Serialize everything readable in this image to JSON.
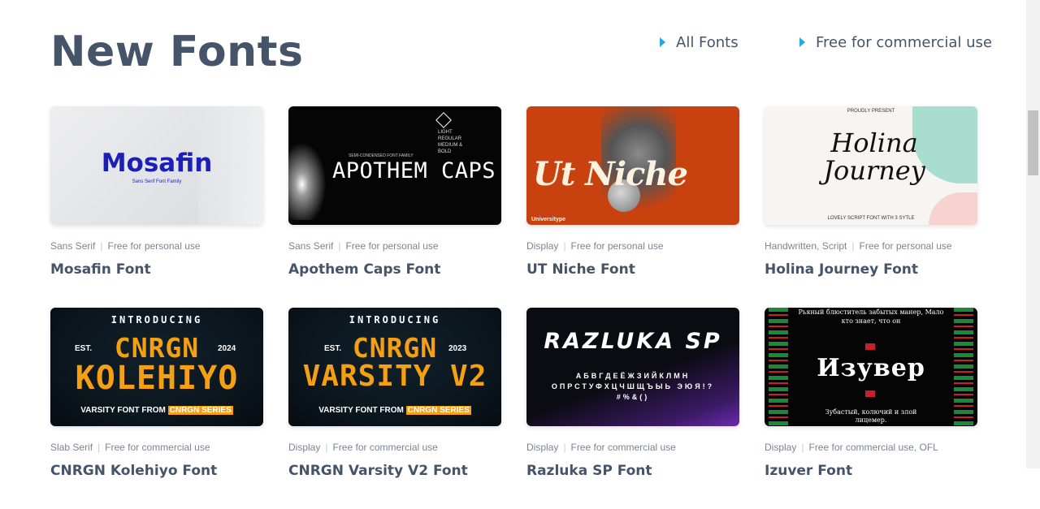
{
  "header": {
    "title": "New Fonts",
    "links": [
      {
        "label": "All Fonts"
      },
      {
        "label": "Free for commercial use"
      }
    ]
  },
  "accent_color": "#25a9e0",
  "cards": [
    {
      "category": "Sans Serif",
      "license": "Free for personal use",
      "name": "Mosafin Font",
      "thumb": {
        "text": "Mosafin",
        "sub": "Sans Serif Font Family"
      }
    },
    {
      "category": "Sans Serif",
      "license": "Free for personal use",
      "name": "Apothem Caps Font",
      "thumb": {
        "text": "APOTHEM CAPS",
        "sub": "SEMI-CONDENSED FONT FAMILY",
        "weights": "LIGHT REGULAR MEDIUM & BOLD"
      }
    },
    {
      "category": "Display",
      "license": "Free for personal use",
      "name": "UT Niche Font",
      "thumb": {
        "text": "Ut Niche",
        "brand": "Universitype"
      }
    },
    {
      "category": "Handwritten, Script",
      "license": "Free for personal use",
      "name": "Holina Journey Font",
      "thumb": {
        "top": "PROUDLY PRESENT",
        "text": "Holina Journey",
        "foot": "LOVELY SCRIPT FONT WITH 3 SYTLE"
      }
    },
    {
      "category": "Slab Serif",
      "license": "Free for commercial use",
      "name": "CNRGN Kolehiyo Font",
      "thumb": {
        "intro": "INTRODUCING",
        "est": "EST.",
        "year": "2024",
        "line1": "CNRGN",
        "line2": "KOLEHIYO",
        "foot": "VARSITY FONT FROM",
        "series": "CNRGN SERIES"
      }
    },
    {
      "category": "Display",
      "license": "Free for commercial use",
      "name": "CNRGN Varsity V2 Font",
      "thumb": {
        "intro": "INTRODUCING",
        "est": "EST.",
        "year": "2023",
        "line1": "CNRGN",
        "line2": "VARSITY V2",
        "foot": "VARSITY FONT FROM",
        "series": "CNRGN SERIES"
      }
    },
    {
      "category": "Display",
      "license": "Free for commercial use",
      "name": "Razluka SP Font",
      "thumb": {
        "text": "RAZLUKA SP",
        "alpha": "АБВГДЕЁЖЗИЙКЛМН ОПРСТУФХЦЧШЩЪЫЬ ЭЮЯ!?#%&()"
      }
    },
    {
      "category": "Display",
      "license": "Free for commercial use, OFL",
      "name": "Izuver Font",
      "thumb": {
        "top": "Рьяный блюститель забытых манер, Мало кто знает, что он",
        "text": "Изувер",
        "foot": "Зубастый, колючий и злой лицемер."
      }
    }
  ]
}
